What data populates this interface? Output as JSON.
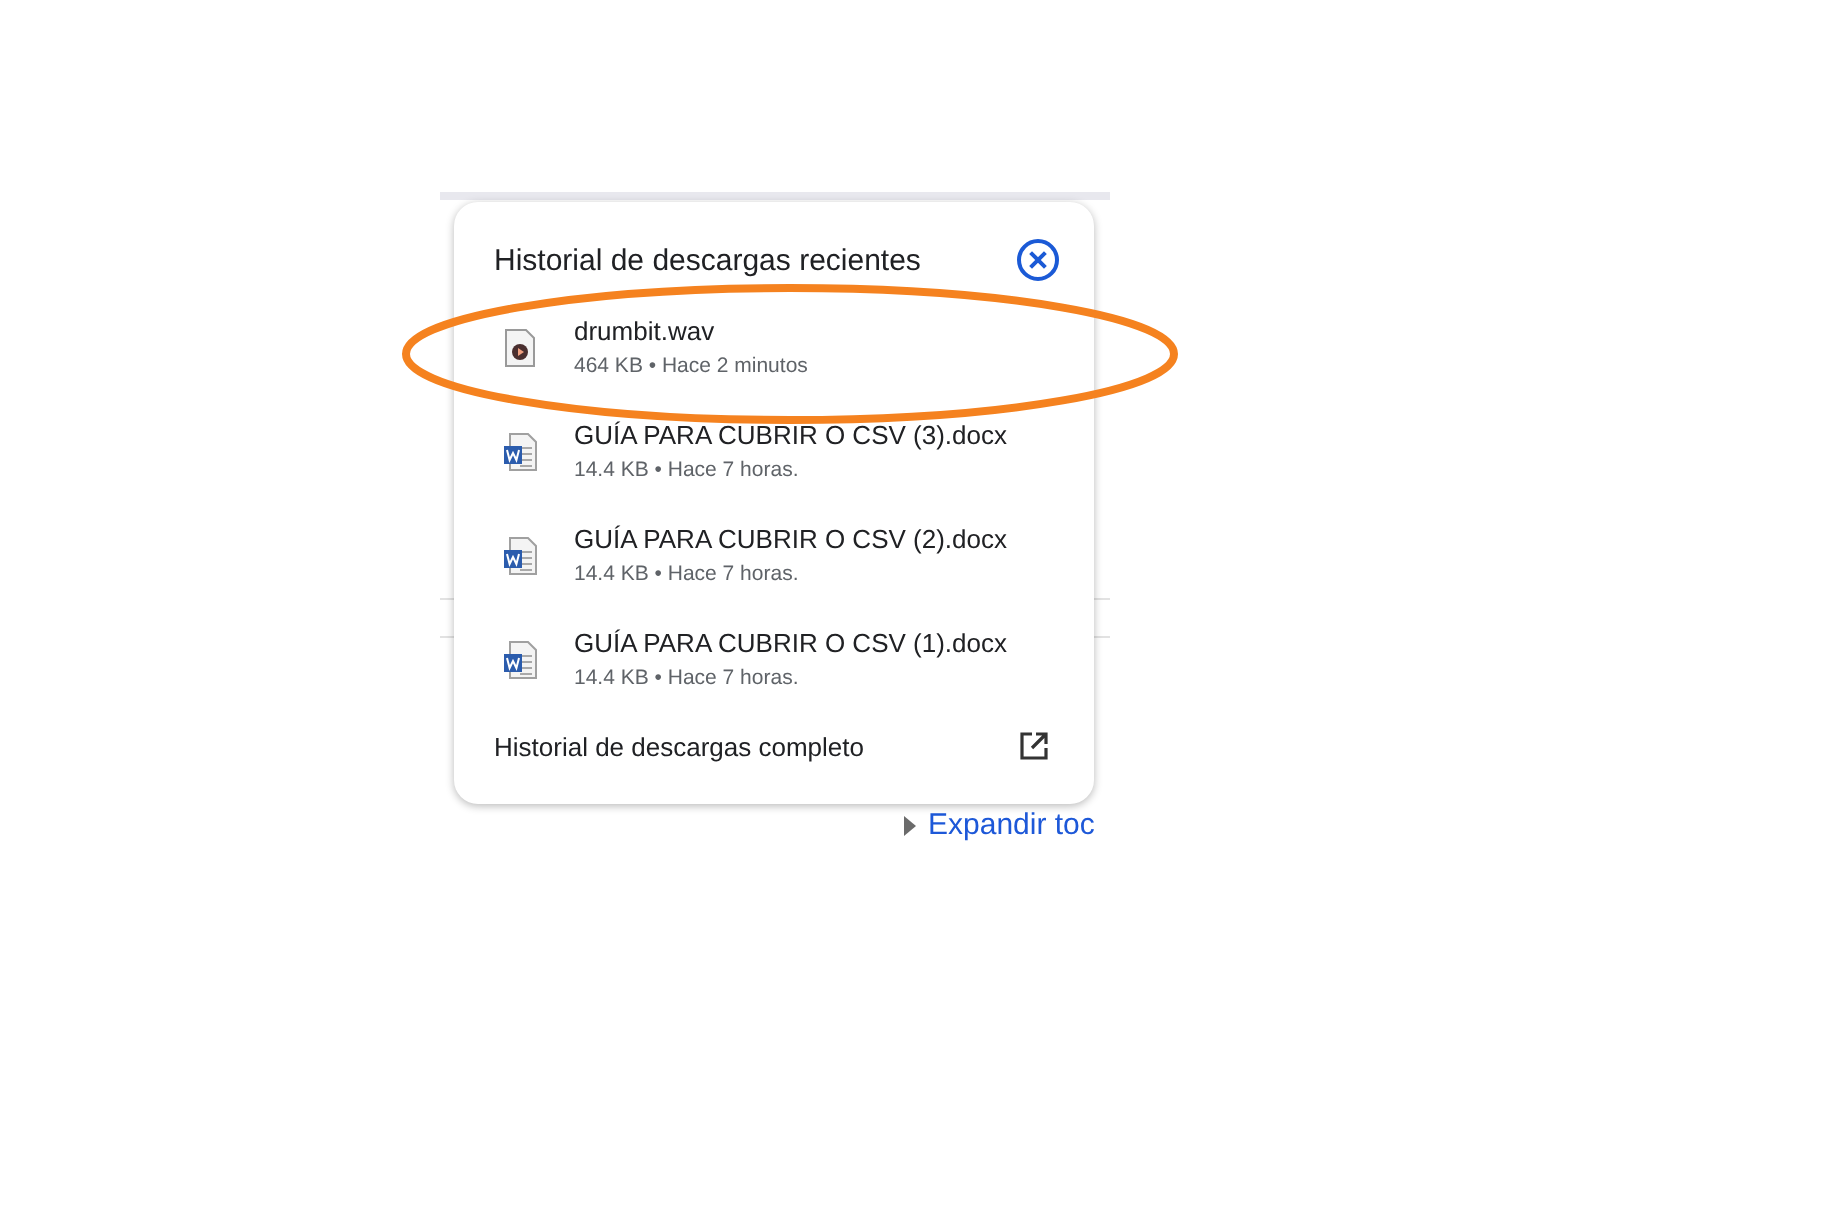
{
  "popup": {
    "title": "Historial de descargas recientes",
    "items": [
      {
        "kind": "audio",
        "name": "drumbit.wav",
        "details": "464 KB • Hace 2 minutos",
        "highlighted": true
      },
      {
        "kind": "word",
        "name": "GUÍA PARA CUBRIR O CSV (3).docx",
        "details": "14.4 KB • Hace 7 horas.",
        "highlighted": false
      },
      {
        "kind": "word",
        "name": "GUÍA PARA CUBRIR O CSV (2).docx",
        "details": "14.4 KB • Hace 7 horas.",
        "highlighted": false
      },
      {
        "kind": "word",
        "name": "GUÍA PARA CUBRIR O CSV (1).docx",
        "details": "14.4 KB • Hace 7 horas.",
        "highlighted": false
      }
    ],
    "footer": "Historial de descargas completo"
  },
  "background": {
    "link": "Expandir toc"
  }
}
